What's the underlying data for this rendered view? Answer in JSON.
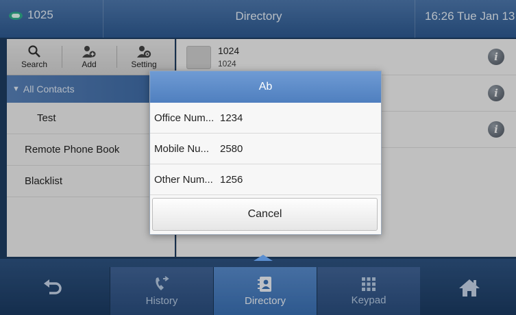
{
  "status_bar": {
    "line": "1025",
    "title": "Directory",
    "clock": "16:26 Tue Jan 13"
  },
  "toolbar": {
    "search": "Search",
    "add": "Add",
    "setting": "Setting"
  },
  "sidebar": {
    "group": "All Contacts",
    "items": [
      {
        "label": "Test"
      },
      {
        "label": "Remote Phone Book"
      },
      {
        "label": "Blacklist"
      }
    ]
  },
  "contacts": [
    {
      "name": "1024",
      "number": "1024"
    }
  ],
  "dialog": {
    "title": "Ab",
    "rows": [
      {
        "label": "Office Num...",
        "value": "1234"
      },
      {
        "label": "Mobile Nu...",
        "value": "2580"
      },
      {
        "label": "Other Num...",
        "value": "1256"
      }
    ],
    "cancel": "Cancel"
  },
  "bottom_nav": {
    "history": "History",
    "directory": "Directory",
    "keypad": "Keypad"
  },
  "colors": {
    "header": "#3b6aa4",
    "accent": "#4f7fbf",
    "line_icon": "#2fae8e"
  }
}
